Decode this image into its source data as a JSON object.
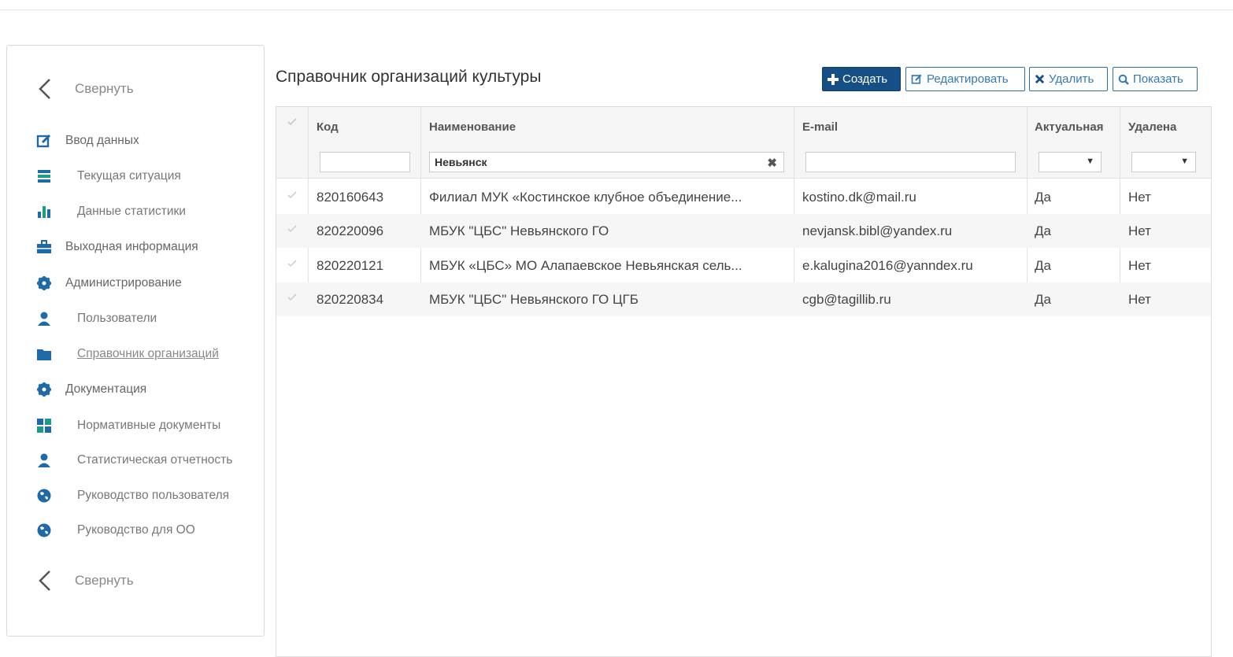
{
  "sidebar": {
    "collapse_top": "Свернуть",
    "collapse_bottom": "Свернуть",
    "items": [
      {
        "label": "Ввод данных",
        "icon": "edit-icon"
      },
      {
        "label": "Текущая ситуация",
        "icon": "list-icon"
      },
      {
        "label": "Данные статистики",
        "icon": "bar-chart-icon"
      },
      {
        "label": "Выходная информация",
        "icon": "briefcase-icon"
      },
      {
        "label": "Администрирование",
        "icon": "gear-icon"
      },
      {
        "label": "Пользователи",
        "icon": "user-icon"
      },
      {
        "label": "Справочник организаций",
        "icon": "folder-icon"
      },
      {
        "label": "Документация",
        "icon": "gear-icon"
      },
      {
        "label": "Нормативные документы",
        "icon": "grid-icon"
      },
      {
        "label": "Статистическая отчетность",
        "icon": "user-icon"
      },
      {
        "label": "Руководство пользователя",
        "icon": "globe-icon"
      },
      {
        "label": "Руководство для ОО",
        "icon": "globe-icon"
      }
    ]
  },
  "main": {
    "title": "Справочник организаций культуры",
    "toolbar": {
      "create": "Создать",
      "edit": "Редактировать",
      "delete": "Удалить",
      "show": "Показать"
    },
    "table": {
      "columns": {
        "code": "Код",
        "name": "Наименование",
        "email": "E-mail",
        "actual": "Актуальная",
        "deleted": "Удалена"
      },
      "filters": {
        "code": "",
        "name": "Невьянск",
        "email": ""
      },
      "rows": [
        {
          "code": "820160643",
          "name": "Филиал МУК «Костинское клубное объединение...",
          "email": "kostino.dk@mail.ru",
          "actual": "Да",
          "deleted": "Нет"
        },
        {
          "code": "820220096",
          "name": "МБУК \"ЦБС\" Невьянского ГО",
          "email": "nevjansk.bibl@yandex.ru",
          "actual": "Да",
          "deleted": "Нет"
        },
        {
          "code": "820220121",
          "name": "МБУК «ЦБС» МО Алапаевское Невьянская сель...",
          "email": "e.kalugina2016@yanndex.ru",
          "actual": "Да",
          "deleted": "Нет"
        },
        {
          "code": "820220834",
          "name": "МБУК \"ЦБС\" Невьянского ГО ЦГБ",
          "email": "cgb@tagillib.ru",
          "actual": "Да",
          "deleted": "Нет"
        }
      ]
    }
  },
  "colors": {
    "primary": "#154f86",
    "link": "#337ab7",
    "icon": "#1e6aa8",
    "icon_green": "#1a9b8c"
  }
}
